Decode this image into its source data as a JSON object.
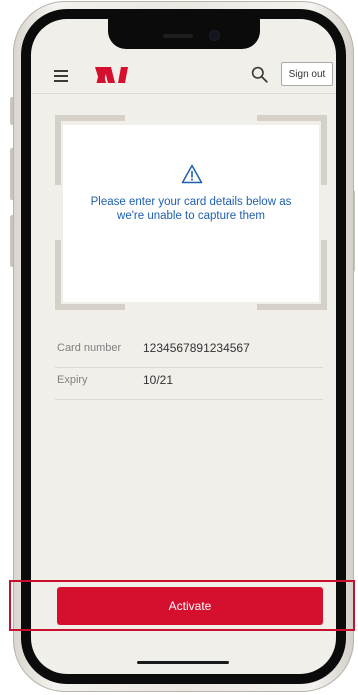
{
  "header": {
    "sign_out_label": "Sign out"
  },
  "icons": {
    "menu": "hamburger-menu-icon",
    "logo": "westpac-logo",
    "search": "search-icon",
    "warning": "warning-triangle-icon"
  },
  "scan": {
    "message": "Please enter your card details below as we're unable to capture them"
  },
  "details": [
    {
      "label": "Card number",
      "value": "1234567891234567"
    },
    {
      "label": "Expiry",
      "value": "10/21"
    }
  ],
  "actions": {
    "activate_label": "Activate"
  },
  "colors": {
    "brand_red": "#d5102f",
    "link_blue": "#1f5fb0",
    "screen_bg": "#f1efea",
    "highlight_red": "#c8102e"
  }
}
